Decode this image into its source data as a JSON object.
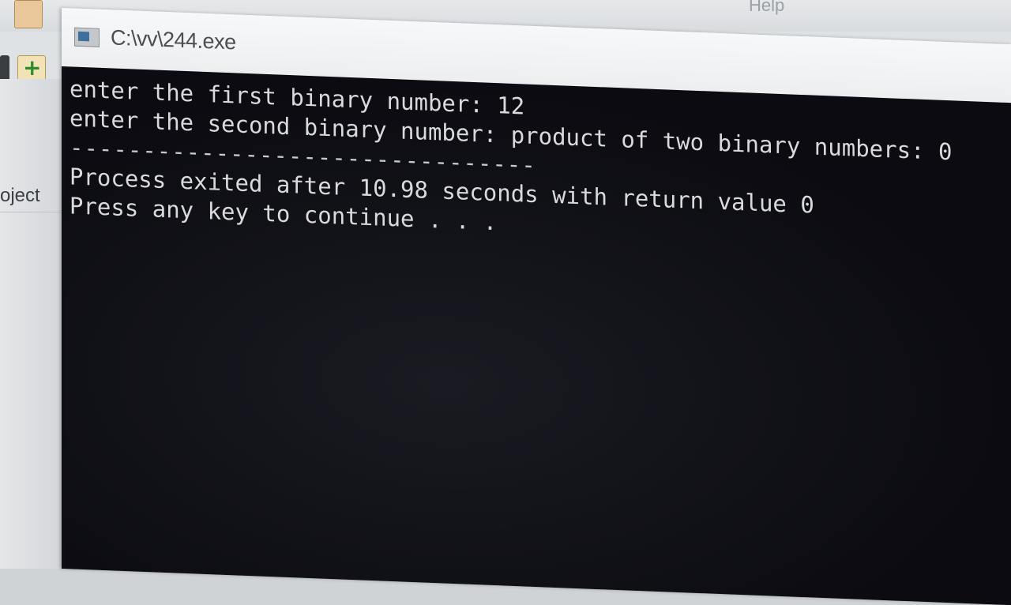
{
  "ide": {
    "menu_help": "Help",
    "side_label": "oject"
  },
  "console": {
    "title": "C:\\vv\\244.exe",
    "lines": [
      "enter the first binary number: 12",
      "enter the second binary number: product of two binary numbers: 0",
      "--------------------------------",
      "Process exited after 10.98 seconds with return value 0",
      "Press any key to continue . . ."
    ]
  }
}
